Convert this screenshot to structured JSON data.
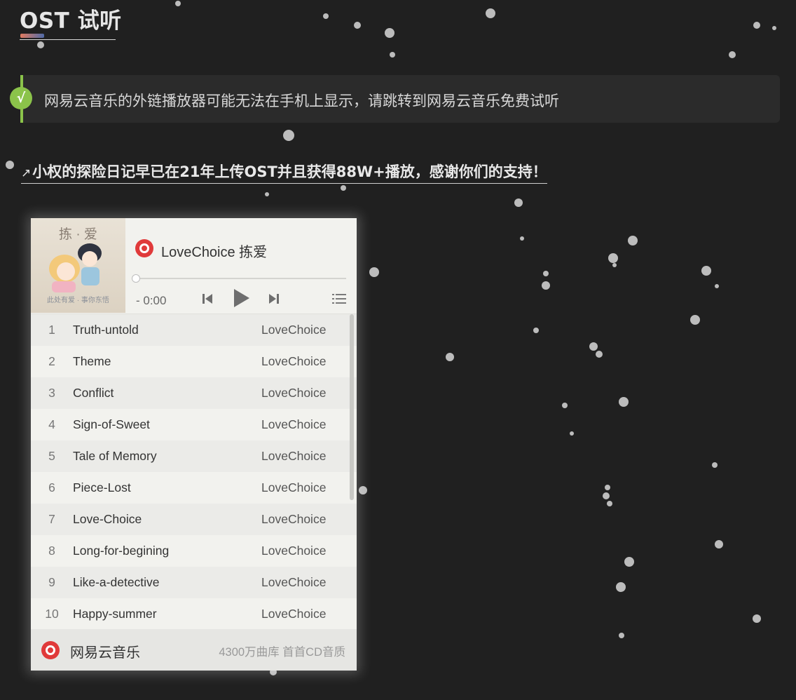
{
  "heading": "OST 试听",
  "note": {
    "icon": "√",
    "text": "网易云音乐的外链播放器可能无法在手机上显示，请跳转到网易云音乐免费试听"
  },
  "link": {
    "icon": "external-link-icon",
    "text": "小权的探险日记早已在21年上传OST并且获得88W+播放，感谢你们的支持！"
  },
  "player": {
    "cover_title": "拣 · 爱",
    "cover_caption": "此处有爱 · 事你东悟",
    "title": "LoveChoice 拣爱",
    "time": "- 0:00",
    "tracks": [
      {
        "num": "1",
        "name": "Truth-untold",
        "artist": "LoveChoice"
      },
      {
        "num": "2",
        "name": "Theme",
        "artist": "LoveChoice"
      },
      {
        "num": "3",
        "name": "Conflict",
        "artist": "LoveChoice"
      },
      {
        "num": "4",
        "name": "Sign-of-Sweet",
        "artist": "LoveChoice"
      },
      {
        "num": "5",
        "name": "Tale of Memory",
        "artist": "LoveChoice"
      },
      {
        "num": "6",
        "name": "Piece-Lost",
        "artist": "LoveChoice"
      },
      {
        "num": "7",
        "name": "Love-Choice",
        "artist": "LoveChoice"
      },
      {
        "num": "8",
        "name": "Long-for-begining",
        "artist": "LoveChoice"
      },
      {
        "num": "9",
        "name": "Like-a-detective",
        "artist": "LoveChoice"
      },
      {
        "num": "10",
        "name": "Happy-summer",
        "artist": "LoveChoice"
      }
    ],
    "footer_brand": "网易云音乐",
    "footer_tag": "4300万曲库 首首CD音质",
    "brand_color": "#e03a3a"
  },
  "colors": {
    "background": "#202020",
    "note_accent": "#8bc34a"
  }
}
